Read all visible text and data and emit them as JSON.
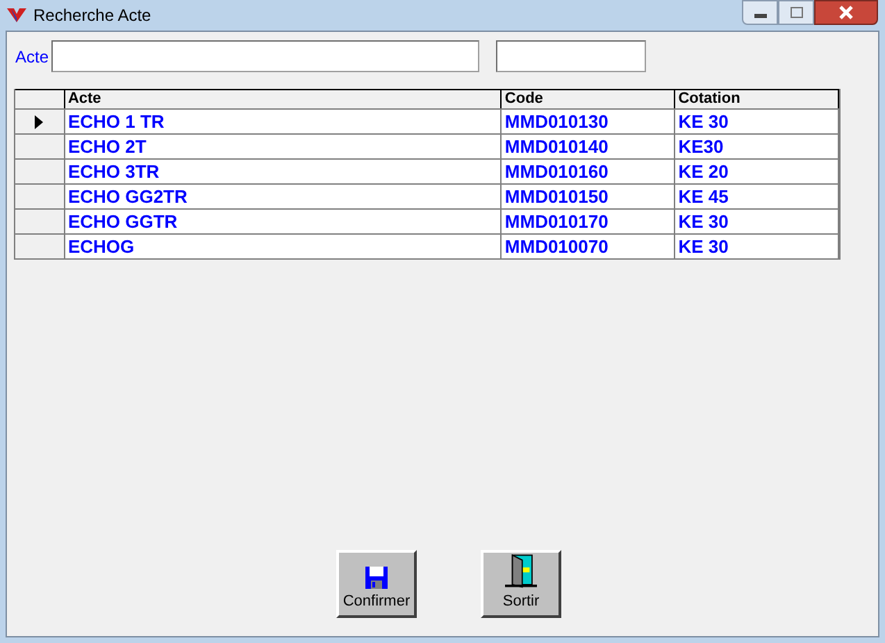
{
  "window": {
    "title": "Recherche Acte"
  },
  "search": {
    "label": "Acte"
  },
  "table": {
    "columns": [
      "Acte",
      "Code",
      "Cotation"
    ],
    "rows": [
      {
        "cells": [
          "ECHO 1 TR",
          "MMD010130",
          "KE 30"
        ],
        "selected": true
      },
      {
        "cells": [
          "ECHO 2T",
          "MMD010140",
          "KE30"
        ],
        "selected": false
      },
      {
        "cells": [
          "ECHO 3TR",
          "MMD010160",
          "KE 20"
        ],
        "selected": false
      },
      {
        "cells": [
          "ECHO GG2TR",
          "MMD010150",
          "KE 45"
        ],
        "selected": false
      },
      {
        "cells": [
          "ECHO GGTR",
          "MMD010170",
          "KE 30"
        ],
        "selected": false
      },
      {
        "cells": [
          "ECHOG",
          "MMD010070",
          "KE 30"
        ],
        "selected": false
      }
    ]
  },
  "buttons": [
    {
      "label": "Confirmer",
      "kind": "save"
    },
    {
      "label": "Sortir",
      "kind": "exit"
    }
  ]
}
